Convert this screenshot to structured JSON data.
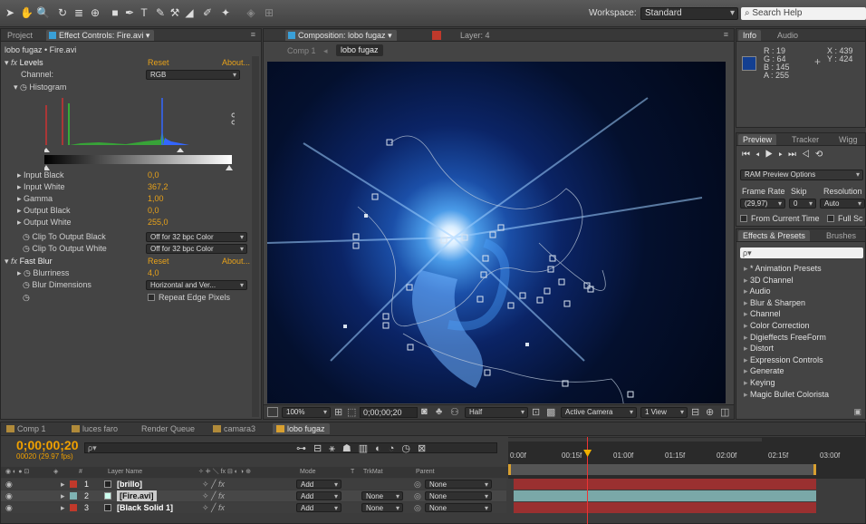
{
  "workspace": {
    "label": "Workspace:",
    "value": "Standard"
  },
  "search": {
    "placeholder": "Search Help"
  },
  "left_panel": {
    "tabs": [
      "Project",
      "Effect Controls: Fire.avi"
    ],
    "subtitle": "lobo fugaz • Fire.avi",
    "levels": {
      "name": "Levels",
      "reset": "Reset",
      "about": "About...",
      "channel_label": "Channel:",
      "channel_value": "RGB",
      "histogram_label": "Histogram"
    },
    "params": [
      {
        "label": "Input Black",
        "value": "0,0"
      },
      {
        "label": "Input White",
        "value": "367,2"
      },
      {
        "label": "Gamma",
        "value": "1,00"
      },
      {
        "label": "Output Black",
        "value": "0,0"
      },
      {
        "label": "Output White",
        "value": "255,0"
      }
    ],
    "clip_black": {
      "label": "Clip To Output Black",
      "value": "Off for 32 bpc Color"
    },
    "clip_white": {
      "label": "Clip To Output White",
      "value": "Off for 32 bpc Color"
    },
    "fast_blur": {
      "name": "Fast Blur",
      "reset": "Reset",
      "about": "About...",
      "blurriness_label": "Blurriness",
      "blurriness_value": "4,0",
      "dims_label": "Blur Dimensions",
      "dims_value": "Horizontal and Ver...",
      "repeat_label": "Repeat Edge Pixels"
    }
  },
  "comp_panel": {
    "tabs": [
      "Composition: lobo fugaz",
      "Layer: 4"
    ],
    "breadcrumbs": [
      "Comp 1",
      "lobo fugaz"
    ],
    "footer": {
      "zoom": "100%",
      "timecode": "0;00;00;20",
      "resolution": "Half",
      "camera": "Active Camera",
      "view": "1 View"
    }
  },
  "info_panel": {
    "tabs": [
      "Info",
      "Audio"
    ],
    "r": "R : 19",
    "g": "G : 64",
    "b": "B : 145",
    "a": "A : 255",
    "x": "X : 439",
    "y": "Y : 424",
    "swatch_color": "#133f91"
  },
  "preview_panel": {
    "tabs": [
      "Preview",
      "Tracker",
      "Wigg"
    ],
    "ram_options": "RAM Preview Options",
    "headers": [
      "Frame Rate",
      "Skip",
      "Resolution"
    ],
    "frame_rate": "(29,97)",
    "skip": "0",
    "resolution": "Auto",
    "from_current": "From Current Time",
    "full_screen": "Full Sc"
  },
  "effects_panel": {
    "tabs": [
      "Effects & Presets",
      "Brushes"
    ],
    "search_placeholder": "ρ▾",
    "items": [
      "* Animation Presets",
      "3D Channel",
      "Audio",
      "Blur & Sharpen",
      "Channel",
      "Color Correction",
      "Digieffects FreeForm",
      "Distort",
      "Expression Controls",
      "Generate",
      "Keying",
      "Magic Bullet Colorista"
    ]
  },
  "timeline": {
    "tabs": [
      "Comp 1",
      "luces faro",
      "Render Queue",
      "camara3",
      "lobo fugaz"
    ],
    "timecode": "0;00;00;20",
    "frame_info": "00020 (29.97 fps)",
    "ruler": [
      "0:00f",
      "00:15f",
      "01:00f",
      "01:15f",
      "02:00f",
      "02:15f",
      "03:00f"
    ],
    "col_headers": {
      "num": "#",
      "name": "Layer Name",
      "mode": "Mode",
      "t": "T",
      "trkmat": "TrkMat",
      "parent": "Parent"
    },
    "layers": [
      {
        "num": "1",
        "name": "[brillo]",
        "mode": "Add",
        "trkmat": "",
        "parent": "None",
        "color": "#c0392b"
      },
      {
        "num": "2",
        "name": "[Fire.avi]",
        "mode": "Add",
        "trkmat": "None",
        "parent": "None",
        "color": "#7fb3b3"
      },
      {
        "num": "3",
        "name": "[Black Solid 1]",
        "mode": "Add",
        "trkmat": "None",
        "parent": "None",
        "color": "#c0392b"
      }
    ],
    "playhead_fraction": 0.22
  }
}
